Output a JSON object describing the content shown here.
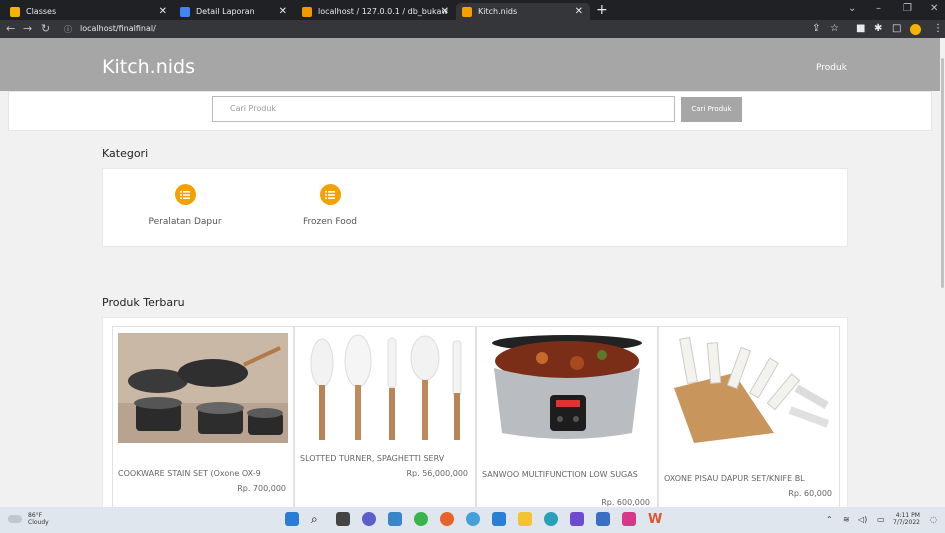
{
  "browser": {
    "tabs": [
      {
        "title": "Classes",
        "color": "#f4b400"
      },
      {
        "title": "Detail Laporan",
        "color": "#4285f4"
      },
      {
        "title": "localhost / 127.0.0.1 / db_bukaw",
        "color": "#f29900"
      },
      {
        "title": "Kitch.nids",
        "color": "#f4a100"
      }
    ],
    "url": "localhost/finalfinal/"
  },
  "site": {
    "brand": "Kitch.nids",
    "nav_produk": "Produk",
    "search_placeholder": "Cari Produk",
    "search_button": "Cari Produk",
    "kategori_title": "Kategori",
    "kategori": [
      {
        "label": "Peralatan Dapur",
        "icon": "list-icon"
      },
      {
        "label": "Frozen Food",
        "icon": "list-icon"
      }
    ],
    "produk_title": "Produk Terbaru",
    "products": [
      {
        "name": "COOKWARE STAIN SET (Oxone OX-9",
        "price": "Rp. 700,000"
      },
      {
        "name": "SLOTTED TURNER, SPAGHETTI SERV",
        "price": "Rp. 56,000,000"
      },
      {
        "name": "SANWOO MULTIFUNCTION LOW SUGAS",
        "price": "Rp. 600,000"
      },
      {
        "name": "OXONE PISAU DAPUR SET/KNIFE BL",
        "price": "Rp. 60,000"
      }
    ]
  },
  "taskbar": {
    "temperature": "86°F",
    "weather": "Cloudy",
    "time": "4:11 PM",
    "date": "7/7/2022"
  }
}
